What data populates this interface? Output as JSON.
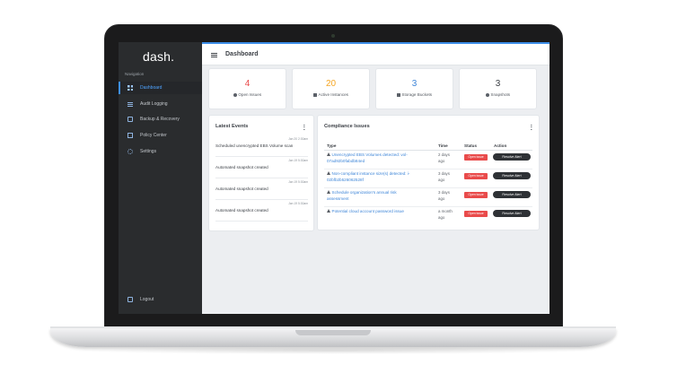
{
  "sidebar": {
    "logo": "dash.",
    "nav_caption": "Navigation",
    "items": [
      {
        "label": "Dashboard",
        "icon": "grid-icon"
      },
      {
        "label": "Audit Logging",
        "icon": "list-icon"
      },
      {
        "label": "Backup & Recovery",
        "icon": "storage-icon"
      },
      {
        "label": "Policy Center",
        "icon": "checklist-icon"
      },
      {
        "label": "Settings",
        "icon": "gear-icon"
      }
    ],
    "logout": {
      "label": "Logout",
      "icon": "logout-icon"
    }
  },
  "header": {
    "title": "Dashboard"
  },
  "stats": [
    {
      "value": "4",
      "label": "Open Issues",
      "icon": "info-circle-icon",
      "color": "#e94b4b"
    },
    {
      "value": "20",
      "label": "Active Instances",
      "icon": "cubes-icon",
      "color": "#f5a623"
    },
    {
      "value": "3",
      "label": "Storage Buckets",
      "icon": "database-icon",
      "color": "#3f86d8"
    },
    {
      "value": "3",
      "label": "Snapshots",
      "icon": "clock-icon",
      "color": "#3a3e44"
    }
  ],
  "events": {
    "title": "Latest Events",
    "items": [
      {
        "time": "Jan 20 2:30am",
        "text": "Scheduled unencrypted EBS Volume scan"
      },
      {
        "time": "Jan 19 5:30am",
        "text": "Automated snapshot created"
      },
      {
        "time": "Jan 19 5:30am",
        "text": "Automated snapshot created"
      },
      {
        "time": "Jan 19 5:30am",
        "text": "Automated snapshot created"
      }
    ]
  },
  "compliance": {
    "title": "Compliance Issues",
    "columns": [
      "Type",
      "Time",
      "Status",
      "Action"
    ],
    "rows": [
      {
        "type_line1": "Unencrypted EBS Volumes detected: vol-",
        "type_line2": "07ad92b0fabdb84ed",
        "time_line1": "2 days",
        "time_line2": "ago",
        "status": "Open issue",
        "action": "Resolve Alert"
      },
      {
        "type_line1": "Non-compliant instance size(s) detected: i-",
        "type_line2": "02bfb2b526062528f",
        "time_line1": "3 days",
        "time_line2": "ago",
        "status": "Open issue",
        "action": "Resolve Alert"
      },
      {
        "type_line1": "Schedule organization's annual risk",
        "type_line2": "assessment",
        "time_line1": "3 days",
        "time_line2": "ago",
        "status": "Open issue",
        "action": "Resolve Alert"
      },
      {
        "type_line1": "Potential cloud account password issue",
        "type_line2": "",
        "time_line1": "a month",
        "time_line2": "ago",
        "status": "Open issue",
        "action": "Resolve Alert"
      }
    ]
  },
  "colors": {
    "accent": "#3d8ee8",
    "sidebar_bg": "#2a2c2e",
    "badge": "#e94b4b",
    "button": "#2f3236"
  }
}
